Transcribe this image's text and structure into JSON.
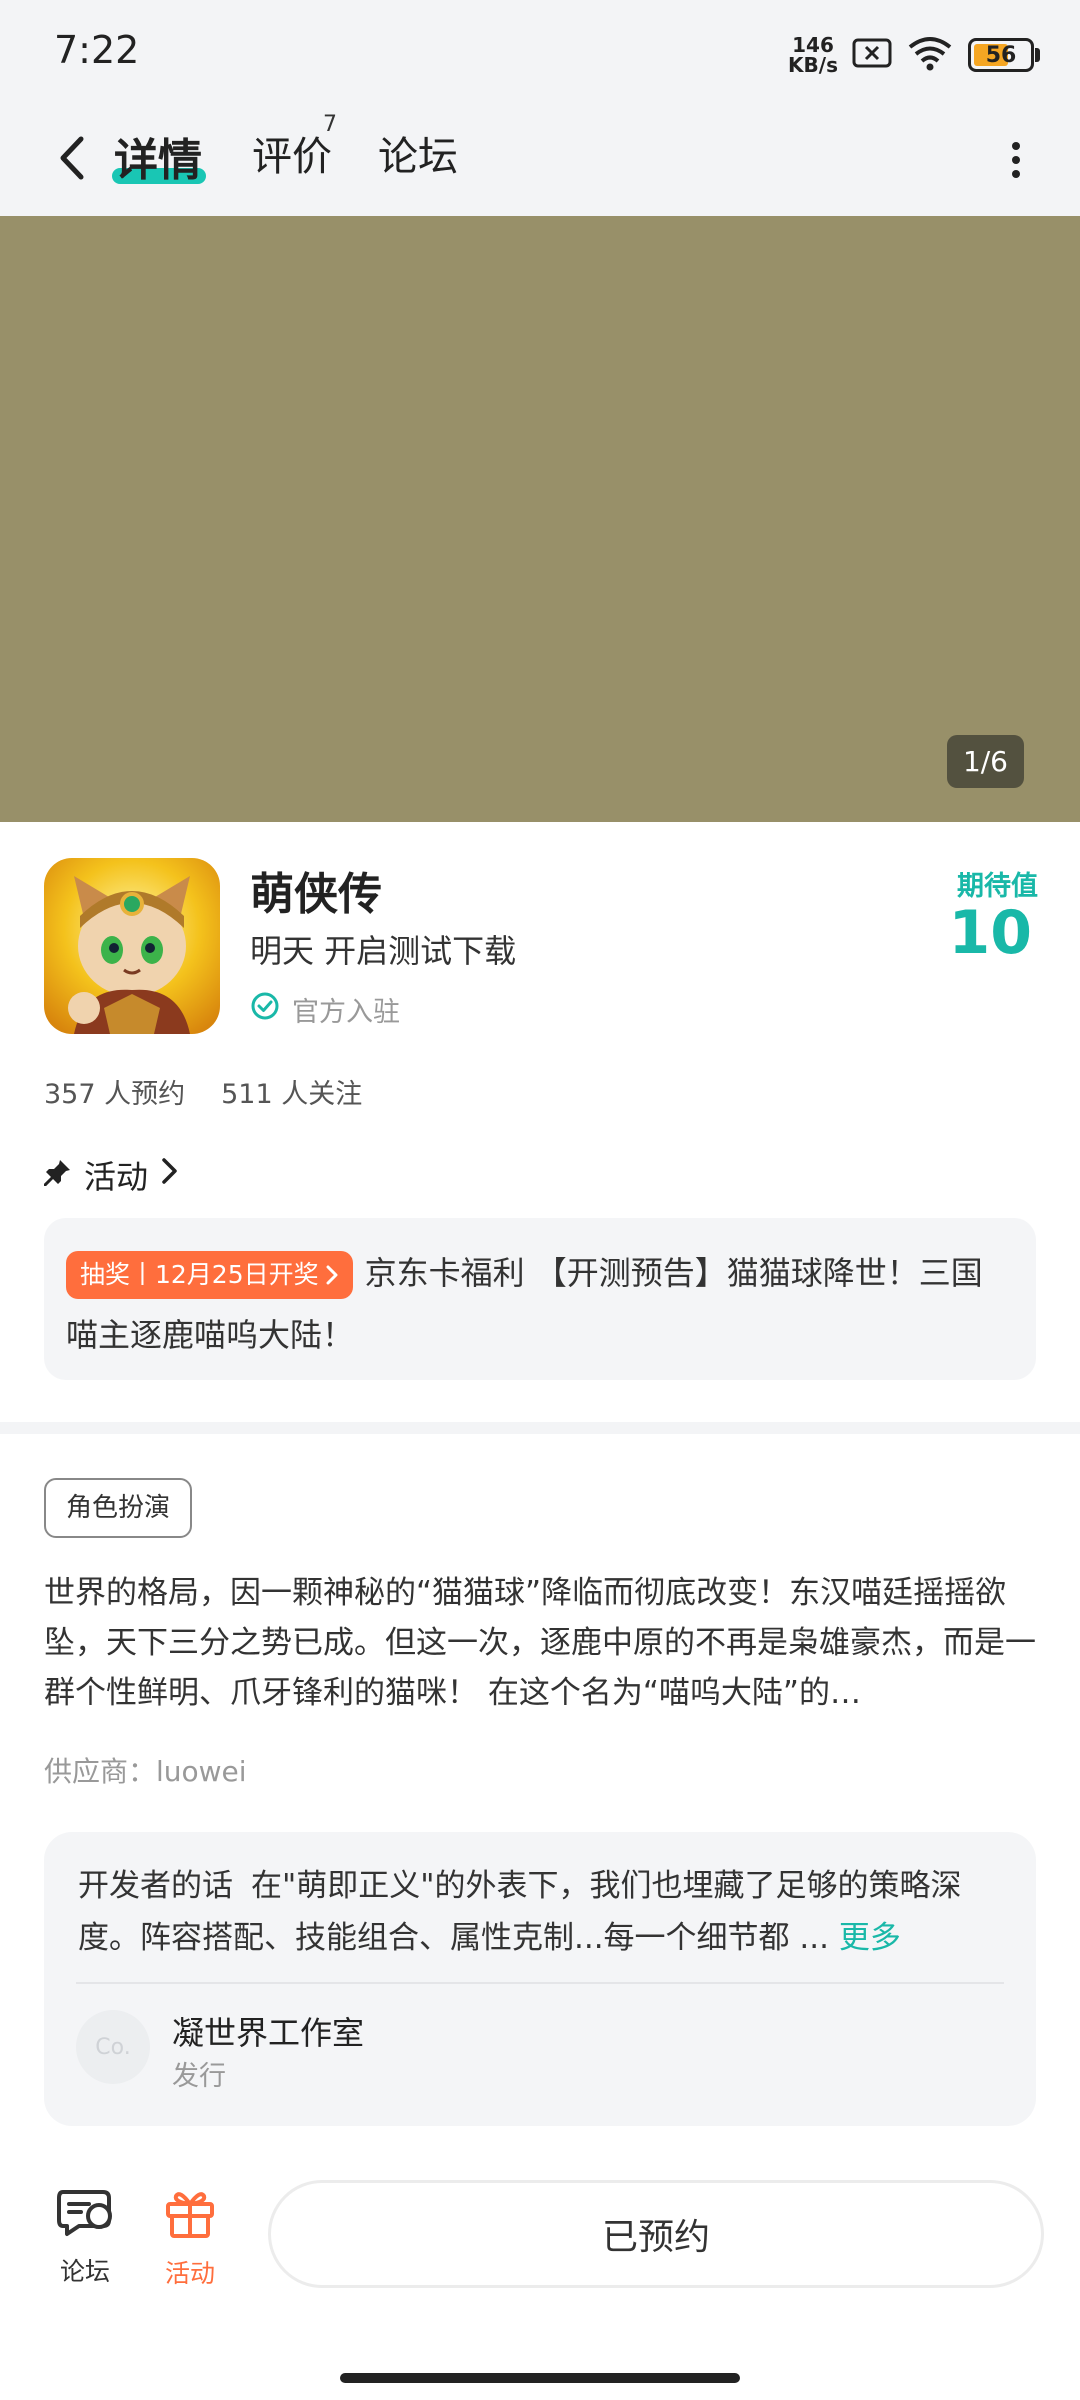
{
  "status_bar": {
    "time": "7:22",
    "net_speed_value": "146",
    "net_speed_unit": "KB/s",
    "battery": "56",
    "icons": [
      "sim-x-icon",
      "wifi-icon",
      "battery-icon"
    ]
  },
  "header": {
    "tabs": [
      {
        "label": "详情",
        "active": true
      },
      {
        "label": "评价",
        "badge": "7"
      },
      {
        "label": "论坛"
      }
    ],
    "accent": "#19c6b4"
  },
  "banner": {
    "counter": "1/6",
    "background": "#989069"
  },
  "game": {
    "title": "萌侠传",
    "subtitle": "明天 开启测试下载",
    "official": "官方入驻",
    "expect_label": "期待值",
    "expect_value": "10",
    "reservations": "357 人预约",
    "followers": "511 人关注"
  },
  "activity": {
    "heading": "活动",
    "tag": "抽奖丨12月25日开奖",
    "text": "京东卡福利 【开测预告】猫猫球降世！三国喵主逐鹿喵呜大陆！"
  },
  "details": {
    "genre": "角色扮演",
    "description": "世界的格局，因一颗神秘的“猫猫球”降临而彻底改变！东汉喵廷摇摇欲坠，天下三分之势已成。但这一次，逐鹿中原的不再是枭雄豪杰，而是一群个性鲜明、爪牙锋利的猫咪！ 在这个名为“喵呜大陆”的…",
    "supplier": "供应商：luowei"
  },
  "developer": {
    "label": "开发者的话",
    "text": "在\"萌即正义\"的外表下，我们也埋藏了足够的策略深度。阵容搭配、技能组合、属性克制...每一个细节都 ...",
    "more": "更多",
    "avatar_text": "Co.",
    "studio": "凝世界工作室",
    "role": "发行"
  },
  "bottom_bar": {
    "forum": "论坛",
    "activity": "活动",
    "reserve": "已预约",
    "activity_color": "#ff6e3d"
  }
}
